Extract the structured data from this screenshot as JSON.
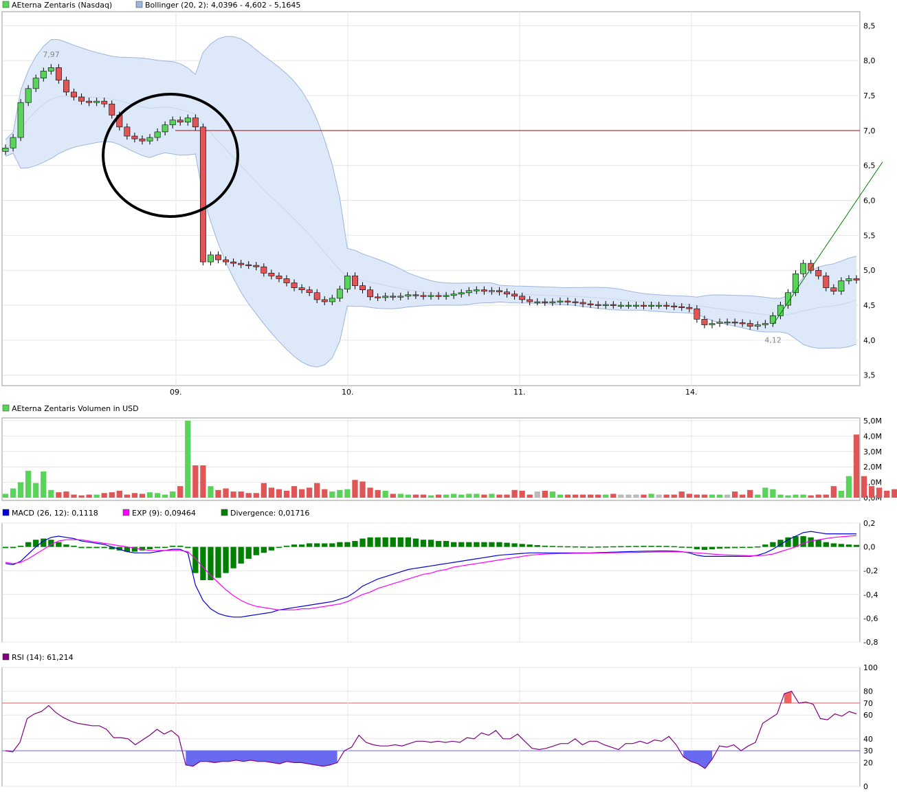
{
  "colors": {
    "up": "#5ad35a",
    "down": "#e05555",
    "neutral": "#bbbbbb",
    "bollinger_fill": "#dde8f8",
    "bollinger_line": "#9db5dd",
    "redline": "#cc0000",
    "macd": "#0000dd",
    "exp": "#ff00ff",
    "divergence": "#008000",
    "rsi": "#800080",
    "rsi_low_fill": "#6a6af0",
    "rsi_high_fill": "#f06060",
    "rsi_70_line": "#cc6666",
    "rsi_30_line": "#6666dd",
    "circle": "#000000",
    "trendline": "#008000"
  },
  "chart_data": [
    {
      "type": "candlestick",
      "legend": [
        "AEterna Zentaris (Nasdaq)",
        "Bollinger (20, 2): 4,0396 - 4,602 - 5,1645"
      ],
      "x_tick_labels": [
        "09.",
        "10.",
        "11.",
        "14."
      ],
      "y_ticks": [
        3.5,
        4.0,
        4.5,
        5.0,
        5.5,
        6.0,
        6.5,
        7.0,
        7.5,
        8.0,
        8.5
      ],
      "y_tick_labels": [
        "3,5",
        "4,0",
        "4,5",
        "5,0",
        "5,5",
        "6,0",
        "6,5",
        "7,0",
        "7,5",
        "8,0",
        "8,5"
      ],
      "ylim": [
        3.35,
        8.7
      ],
      "hline": 7.0,
      "annotations": [
        {
          "text": "7,97",
          "value": 7.97,
          "index": 6
        },
        {
          "text": "4,12",
          "value": 4.12,
          "index": 101
        }
      ],
      "close": [
        6.75,
        6.9,
        7.4,
        7.6,
        7.75,
        7.85,
        7.9,
        7.72,
        7.55,
        7.48,
        7.42,
        7.4,
        7.42,
        7.38,
        7.22,
        7.05,
        6.92,
        6.88,
        6.85,
        6.9,
        6.98,
        7.08,
        7.15,
        7.12,
        7.18,
        7.05,
        5.12,
        5.22,
        5.15,
        5.12,
        5.1,
        5.08,
        5.07,
        5.05,
        4.96,
        4.92,
        4.88,
        4.82,
        4.75,
        4.72,
        4.68,
        4.58,
        4.55,
        4.6,
        4.73,
        4.92,
        4.78,
        4.72,
        4.62,
        4.61,
        4.63,
        4.62,
        4.63,
        4.65,
        4.64,
        4.63,
        4.64,
        4.63,
        4.64,
        4.66,
        4.68,
        4.71,
        4.72,
        4.7,
        4.71,
        4.69,
        4.66,
        4.63,
        4.58,
        4.55,
        4.55,
        4.54,
        4.55,
        4.56,
        4.55,
        4.54,
        4.52,
        4.51,
        4.5,
        4.51,
        4.5,
        4.5,
        4.5,
        4.5,
        4.49,
        4.5,
        4.5,
        4.49,
        4.48,
        4.47,
        4.45,
        4.3,
        4.22,
        4.24,
        4.26,
        4.26,
        4.25,
        4.24,
        4.2,
        4.22,
        4.24,
        4.35,
        4.5,
        4.68,
        4.95,
        5.1,
        5.0,
        4.92,
        4.75,
        4.7,
        4.85,
        4.88,
        4.86
      ],
      "volume_legend": "AEterna Zentaris Volumen in USD",
      "volume_y_ticks": [
        "0,0M",
        "1,0M",
        "2,0M",
        "3,0M",
        "4,0M",
        "5,0M"
      ],
      "volume_ylim": [
        0,
        5.0
      ],
      "volume": [
        0.25,
        0.6,
        1.0,
        1.75,
        0.95,
        1.7,
        0.5,
        0.35,
        0.4,
        0.2,
        0.15,
        0.2,
        0.2,
        0.3,
        0.35,
        0.45,
        0.2,
        0.3,
        0.25,
        0.35,
        0.3,
        0.2,
        0.4,
        0.75,
        5.0,
        2.1,
        2.1,
        0.75,
        0.5,
        0.6,
        0.4,
        0.4,
        0.3,
        0.3,
        0.95,
        0.65,
        0.55,
        0.45,
        0.75,
        0.55,
        0.65,
        0.95,
        0.55,
        0.4,
        0.5,
        0.55,
        1.15,
        1.05,
        0.65,
        0.5,
        0.45,
        0.25,
        0.25,
        0.2,
        0.2,
        0.2,
        0.15,
        0.2,
        0.2,
        0.25,
        0.2,
        0.25,
        0.25,
        0.2,
        0.25,
        0.2,
        0.2,
        0.5,
        0.45,
        0.2,
        0.4,
        0.45,
        0.4,
        0.2,
        0.2,
        0.2,
        0.2,
        0.2,
        0.2,
        0.2,
        0.25,
        0.2,
        0.2,
        0.2,
        0.2,
        0.25,
        0.2,
        0.2,
        0.2,
        0.4,
        0.25,
        0.2,
        0.2,
        0.2,
        0.2,
        0.2,
        0.4,
        0.2,
        0.5,
        0.2,
        0.65,
        0.55,
        0.2,
        0.15,
        0.2,
        0.2,
        0.15,
        0.2,
        0.2,
        0.75,
        0.45,
        1.4,
        4.1,
        1.4,
        0.75,
        0.65,
        0.45,
        0.55,
        0.55,
        0.7
      ]
    },
    {
      "type": "line",
      "legend": [
        "MACD (26, 12): 0,1118",
        "EXP (9): 0,09464",
        "Divergence: 0,01716"
      ],
      "y_ticks": [
        -0.8,
        -0.6,
        -0.4,
        -0.2,
        0.0,
        0.2
      ],
      "y_tick_labels": [
        "-0,8",
        "-0,6",
        "-0,4",
        "-0,2",
        "0,0",
        "0,2"
      ],
      "ylim": [
        -0.8,
        0.2
      ],
      "macd": [
        -0.14,
        -0.15,
        -0.12,
        -0.06,
        0.0,
        0.05,
        0.08,
        0.09,
        0.08,
        0.07,
        0.05,
        0.04,
        0.03,
        0.02,
        0.0,
        -0.02,
        -0.04,
        -0.05,
        -0.05,
        -0.05,
        -0.04,
        -0.03,
        -0.02,
        -0.02,
        -0.05,
        -0.32,
        -0.45,
        -0.52,
        -0.56,
        -0.58,
        -0.59,
        -0.59,
        -0.58,
        -0.57,
        -0.56,
        -0.55,
        -0.53,
        -0.52,
        -0.51,
        -0.5,
        -0.49,
        -0.48,
        -0.47,
        -0.46,
        -0.44,
        -0.42,
        -0.38,
        -0.33,
        -0.3,
        -0.27,
        -0.25,
        -0.23,
        -0.21,
        -0.19,
        -0.18,
        -0.17,
        -0.16,
        -0.15,
        -0.14,
        -0.13,
        -0.12,
        -0.11,
        -0.1,
        -0.09,
        -0.08,
        -0.07,
        -0.065,
        -0.06,
        -0.055,
        -0.05,
        -0.05,
        -0.05,
        -0.05,
        -0.05,
        -0.05,
        -0.05,
        -0.05,
        -0.05,
        -0.048,
        -0.046,
        -0.044,
        -0.042,
        -0.04,
        -0.038,
        -0.036,
        -0.035,
        -0.034,
        -0.034,
        -0.035,
        -0.04,
        -0.05,
        -0.07,
        -0.08,
        -0.08,
        -0.08,
        -0.08,
        -0.08,
        -0.08,
        -0.08,
        -0.07,
        -0.05,
        -0.02,
        0.02,
        0.06,
        0.09,
        0.12,
        0.13,
        0.12,
        0.11,
        0.11,
        0.11,
        0.11,
        0.11
      ],
      "exp": [
        -0.13,
        -0.14,
        -0.13,
        -0.1,
        -0.06,
        -0.02,
        0.02,
        0.05,
        0.06,
        0.06,
        0.06,
        0.05,
        0.04,
        0.03,
        0.02,
        0.01,
        0.0,
        -0.01,
        -0.02,
        -0.03,
        -0.03,
        -0.03,
        -0.03,
        -0.03,
        -0.04,
        -0.1,
        -0.17,
        -0.24,
        -0.3,
        -0.36,
        -0.41,
        -0.45,
        -0.48,
        -0.5,
        -0.51,
        -0.52,
        -0.53,
        -0.53,
        -0.53,
        -0.52,
        -0.52,
        -0.51,
        -0.5,
        -0.49,
        -0.48,
        -0.46,
        -0.43,
        -0.4,
        -0.38,
        -0.35,
        -0.33,
        -0.31,
        -0.29,
        -0.27,
        -0.25,
        -0.23,
        -0.22,
        -0.2,
        -0.19,
        -0.17,
        -0.16,
        -0.15,
        -0.14,
        -0.13,
        -0.12,
        -0.11,
        -0.1,
        -0.09,
        -0.08,
        -0.07,
        -0.065,
        -0.06,
        -0.058,
        -0.056,
        -0.055,
        -0.054,
        -0.053,
        -0.052,
        -0.051,
        -0.05,
        -0.049,
        -0.048,
        -0.047,
        -0.046,
        -0.045,
        -0.044,
        -0.043,
        -0.042,
        -0.041,
        -0.042,
        -0.045,
        -0.05,
        -0.055,
        -0.06,
        -0.065,
        -0.068,
        -0.07,
        -0.072,
        -0.074,
        -0.074,
        -0.07,
        -0.06,
        -0.04,
        -0.02,
        0.0,
        0.03,
        0.05,
        0.06,
        0.07,
        0.08,
        0.085,
        0.09,
        0.095
      ],
      "divergence": [
        -0.01,
        -0.01,
        0.01,
        0.04,
        0.06,
        0.07,
        0.06,
        0.04,
        0.02,
        0.01,
        -0.01,
        -0.01,
        -0.01,
        -0.01,
        -0.02,
        -0.03,
        -0.04,
        -0.04,
        -0.03,
        -0.02,
        -0.01,
        0.0,
        0.01,
        0.01,
        -0.01,
        -0.22,
        -0.28,
        -0.28,
        -0.26,
        -0.22,
        -0.18,
        -0.14,
        -0.1,
        -0.07,
        -0.05,
        -0.03,
        0.0,
        0.01,
        0.02,
        0.02,
        0.03,
        0.03,
        0.03,
        0.03,
        0.04,
        0.04,
        0.05,
        0.07,
        0.08,
        0.08,
        0.08,
        0.08,
        0.08,
        0.08,
        0.07,
        0.06,
        0.06,
        0.05,
        0.05,
        0.04,
        0.04,
        0.04,
        0.04,
        0.04,
        0.04,
        0.04,
        0.035,
        0.03,
        0.025,
        0.02,
        0.015,
        0.01,
        0.008,
        0.006,
        0.005,
        0.004,
        0.003,
        0.002,
        0.003,
        0.004,
        0.005,
        0.006,
        0.007,
        0.008,
        0.009,
        0.009,
        0.009,
        0.008,
        0.006,
        0.002,
        -0.005,
        -0.02,
        -0.025,
        -0.02,
        -0.015,
        -0.012,
        -0.01,
        -0.008,
        -0.006,
        0.004,
        0.02,
        0.04,
        0.06,
        0.08,
        0.09,
        0.09,
        0.08,
        0.06,
        0.04,
        0.03,
        0.025,
        0.02,
        0.017
      ]
    },
    {
      "type": "line",
      "legend": [
        "RSI (14): 61,214"
      ],
      "y_ticks": [
        0,
        20,
        30,
        40,
        60,
        70,
        80,
        100
      ],
      "y_tick_labels": [
        "0",
        "20",
        "30",
        "40",
        "60",
        "70",
        "80",
        "100"
      ],
      "ylim": [
        0,
        100
      ],
      "levels": [
        70,
        30
      ],
      "values": [
        30,
        29,
        37,
        57,
        61,
        63,
        68,
        62,
        58,
        55,
        53,
        52,
        51,
        51,
        48,
        41,
        41,
        40,
        35,
        39,
        43,
        48,
        44,
        47,
        42,
        18,
        17,
        21,
        21,
        20,
        21,
        21,
        22,
        21,
        22,
        21,
        21,
        20,
        19,
        21,
        20,
        20,
        19,
        18,
        17,
        18,
        20,
        30,
        33,
        43,
        37,
        35,
        34,
        34,
        35,
        34,
        36,
        38,
        38,
        37,
        38,
        37,
        38,
        37,
        41,
        40,
        45,
        43,
        47,
        40,
        40,
        44,
        38,
        32,
        31,
        32,
        34,
        36,
        36,
        40,
        35,
        38,
        38,
        35,
        33,
        31,
        36,
        36,
        38,
        36,
        39,
        38,
        42,
        35,
        25,
        21,
        19,
        15,
        23,
        34,
        33,
        35,
        30,
        34,
        37,
        53,
        57,
        61,
        78,
        80,
        70,
        71,
        69,
        57,
        56,
        61,
        59,
        63,
        61
      ]
    }
  ]
}
